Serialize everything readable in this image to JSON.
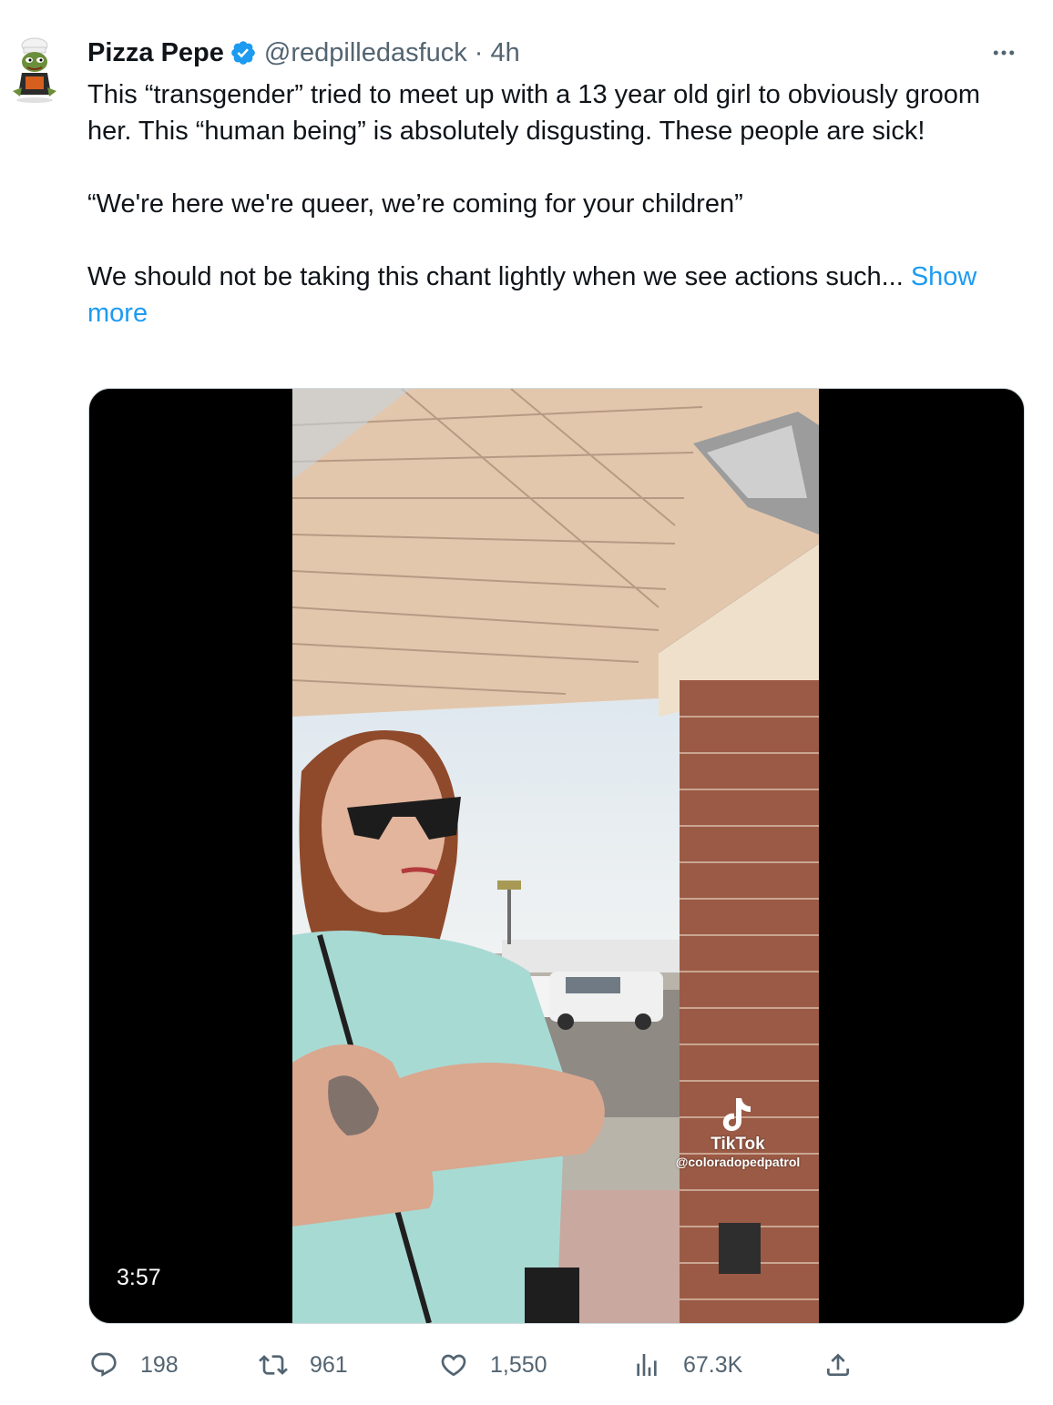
{
  "colors": {
    "accent": "#1d9bf0",
    "text_primary": "#0f1419",
    "text_secondary": "#536471",
    "media_background": "#000000"
  },
  "tweet": {
    "display_name": "Pizza Pepe",
    "verified_icon": "verified-badge-icon",
    "handle": "@redpilledasfuck",
    "separator": "·",
    "time": "4h",
    "more_icon": "more-options-icon",
    "body": {
      "paragraph_1": "This “transgender” tried to meet up with a 13 year old girl to obviously groom her. This “human being” is absolutely disgusting. These people are sick!",
      "paragraph_2": "“We're here we're queer, we’re coming for your children”",
      "paragraph_3": "We should not be taking this chant lightly when we see actions such...",
      "show_more": "Show more"
    },
    "media": {
      "type": "video",
      "duration": "3:57",
      "watermark_brand": "TikTok",
      "watermark_user": "@coloradopedpatrol"
    },
    "actions": {
      "replies": "198",
      "retweets": "961",
      "likes": "1,550",
      "views": "67.3K",
      "reply_icon": "reply-icon",
      "retweet_icon": "retweet-icon",
      "like_icon": "heart-icon",
      "views_icon": "views-chart-icon",
      "share_icon": "share-icon"
    }
  }
}
